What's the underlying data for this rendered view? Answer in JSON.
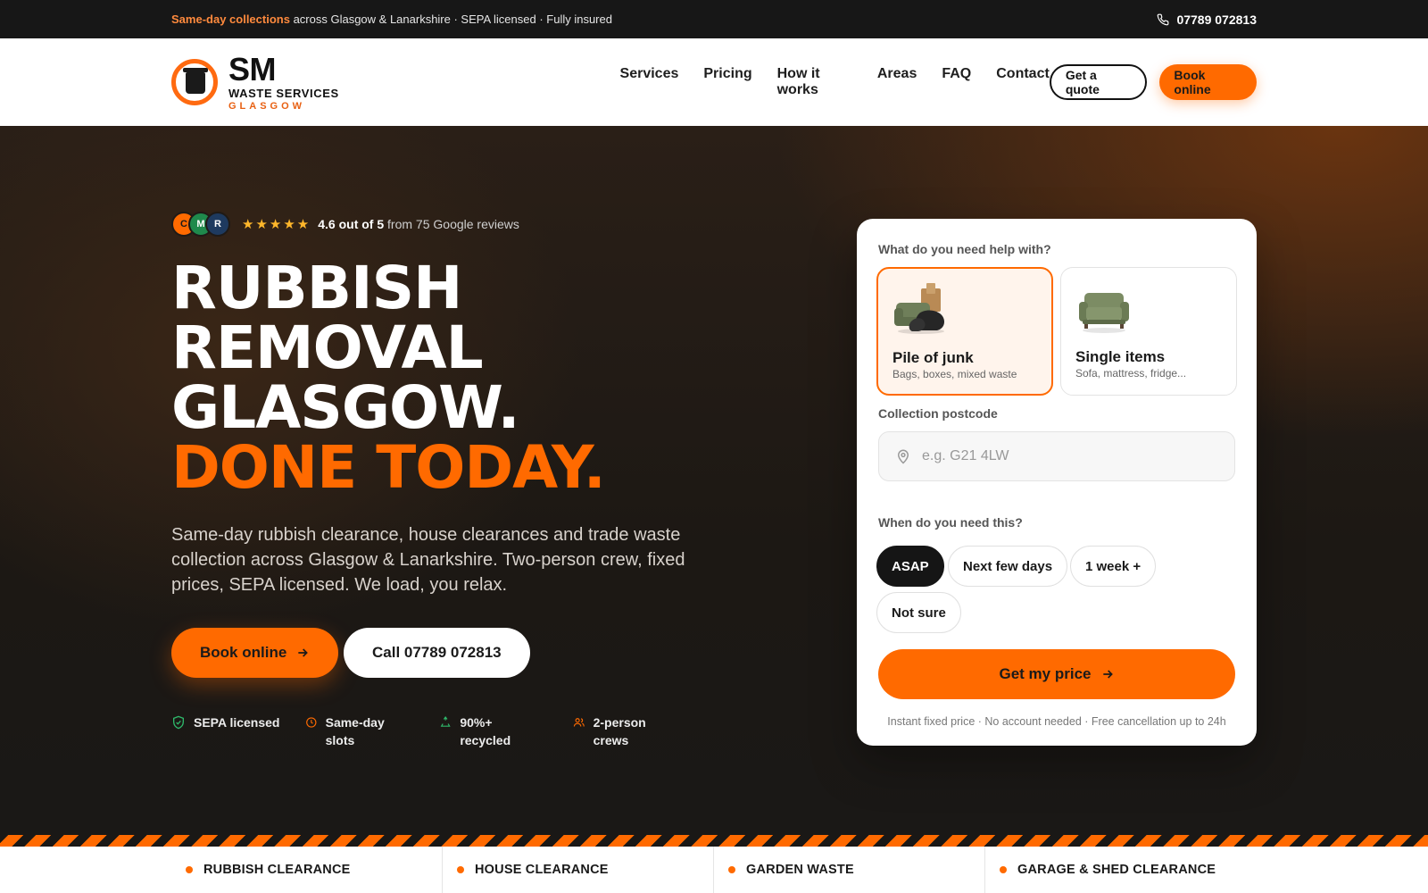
{
  "topbar": {
    "highlight": "Same-day collections",
    "rest": " across Glasgow & Lanarkshire · SEPA licensed · Fully insured",
    "phone": "07789 072813"
  },
  "logo": {
    "main": "SM",
    "line2": "WASTE SERVICES",
    "line3": "GLASGOW"
  },
  "nav": [
    "Services",
    "Pricing",
    "How it works",
    "Areas",
    "FAQ",
    "Contact"
  ],
  "header_actions": {
    "quote": "Get a quote",
    "book": "Book online"
  },
  "hero": {
    "avatars": [
      "C",
      "M",
      "R"
    ],
    "stars": "★★★★★",
    "rating_bold": "4.6 out of 5",
    "rating_rest": " from 75 Google reviews",
    "title_lines": [
      "RUBBISH",
      "REMOVAL",
      "GLASGOW."
    ],
    "title_accent": "DONE TODAY.",
    "lead": "Same-day rubbish clearance, house clearances and trade waste collection across Glasgow & Lanarkshire. Two-person crew, fixed prices, SEPA licensed. We load, you relax.",
    "book_btn": "Book online",
    "call_btn": "Call 07789 072813",
    "trust": [
      "SEPA licensed",
      "Same-day slots",
      "90%+ recycled",
      "2-person crews"
    ],
    "trust_icons": [
      "shield-check-icon",
      "clock-icon",
      "recycle-icon",
      "users-icon"
    ]
  },
  "quote_card": {
    "q1": "What do you need help with?",
    "options": [
      {
        "title": "Pile of junk",
        "sub": "Bags, boxes, mixed waste",
        "selected": true
      },
      {
        "title": "Single items",
        "sub": "Sofa, mattress, fridge...",
        "selected": false
      }
    ],
    "postcode_label": "Collection postcode",
    "postcode_placeholder": "e.g. G21 4LW",
    "when_label": "When do you need this?",
    "when_options": [
      "ASAP",
      "Next few days",
      "1 week +",
      "Not sure"
    ],
    "when_selected": "ASAP",
    "cta": "Get my price",
    "footnote": "Instant fixed price · No account needed · Free cancellation up to 24h"
  },
  "services_strip": [
    "RUBBISH CLEARANCE",
    "HOUSE CLEARANCE",
    "GARDEN WASTE",
    "GARAGE & SHED CLEARANCE"
  ],
  "colors": {
    "accent": "#ff6a00",
    "dark": "#171717",
    "accent_text": "#ff8a3d"
  }
}
